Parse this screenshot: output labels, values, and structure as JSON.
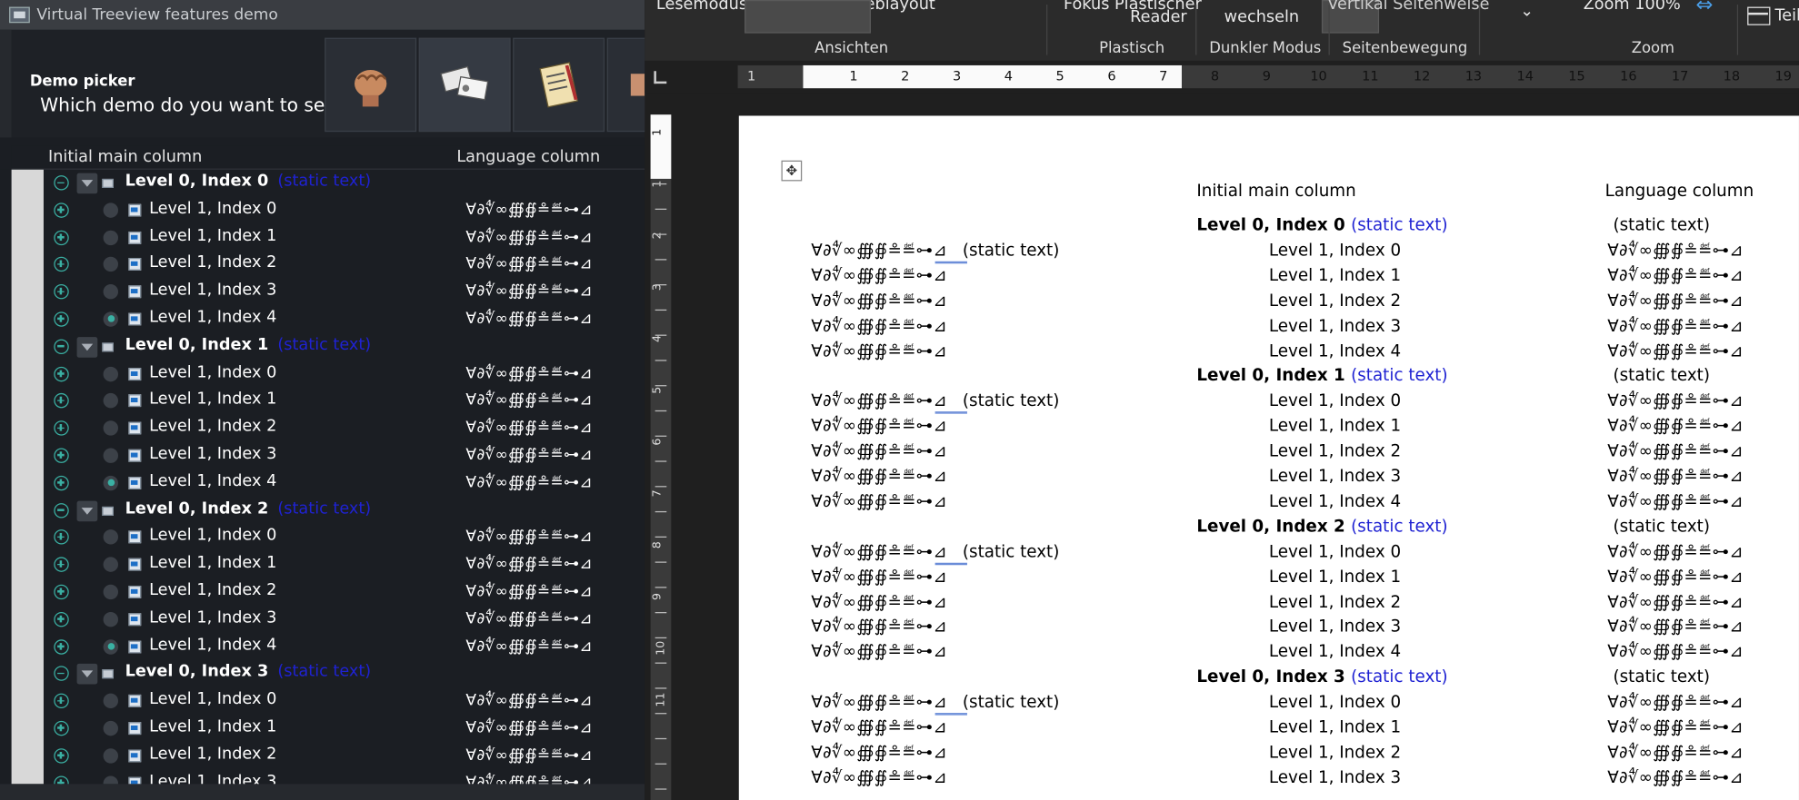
{
  "window": {
    "title": "Virtual Treeview features demo"
  },
  "picker": {
    "heading": "Demo picker",
    "question": "Which demo do you want to see?",
    "thumbnails": [
      "fist-icon",
      "id-cards-icon",
      "checklist-icon",
      "partial-thumbnail"
    ]
  },
  "tree_header": {
    "main": "Initial main column",
    "lang": "Language column"
  },
  "lang_text": "∀∂∜∞∰∯≗≝⊶⊿",
  "static_text": "(static text)",
  "tree": [
    {
      "label": "Level 0, Index 0",
      "children": [
        "Level 1, Index 0",
        "Level 1, Index 1",
        "Level 1, Index 2",
        "Level 1, Index 3",
        "Level 1, Index 4"
      ]
    },
    {
      "label": "Level 0, Index 1",
      "children": [
        "Level 1, Index 0",
        "Level 1, Index 1",
        "Level 1, Index 2",
        "Level 1, Index 3",
        "Level 1, Index 4"
      ]
    },
    {
      "label": "Level 0, Index 2",
      "children": [
        "Level 1, Index 0",
        "Level 1, Index 1",
        "Level 1, Index 2",
        "Level 1, Index 3",
        "Level 1, Index 4"
      ]
    },
    {
      "label": "Level 0, Index 3",
      "children": [
        "Level 1, Index 0",
        "Level 1, Index 1",
        "Level 1, Index 2",
        "Level 1, Index 3"
      ]
    }
  ],
  "ribbon": {
    "top_fragments": [
      "Lesemodus Druckayout Weblayout",
      "Fokus Plastischer",
      "Reader",
      "wechseln",
      "Vertikal Seitenweise",
      "Zoom 100%"
    ],
    "group_labels": [
      "Ansichten",
      "Plastisch",
      "Dunkler Modus",
      "Seitenbewegung",
      "Zoom"
    ],
    "teilen_label": "Teile"
  },
  "ruler": {
    "h_numbers": [
      "1",
      "1",
      "2",
      "3",
      "4",
      "5",
      "6",
      "7",
      "8",
      "9",
      "10",
      "11",
      "12",
      "13",
      "14",
      "15",
      "16",
      "17",
      "18",
      "19"
    ],
    "v_numbers": [
      "1",
      "1",
      "2",
      "3",
      "4",
      "5",
      "6",
      "7",
      "8",
      "9",
      "10",
      "11"
    ]
  },
  "document": {
    "header_main": "Initial main column",
    "header_lang": "Language column"
  },
  "colors": {
    "accent": "#3ab0a3",
    "static_text": "#1f22d2",
    "tree_bg": "#1b1e23",
    "ribbon_bg": "#2b2b2b"
  }
}
